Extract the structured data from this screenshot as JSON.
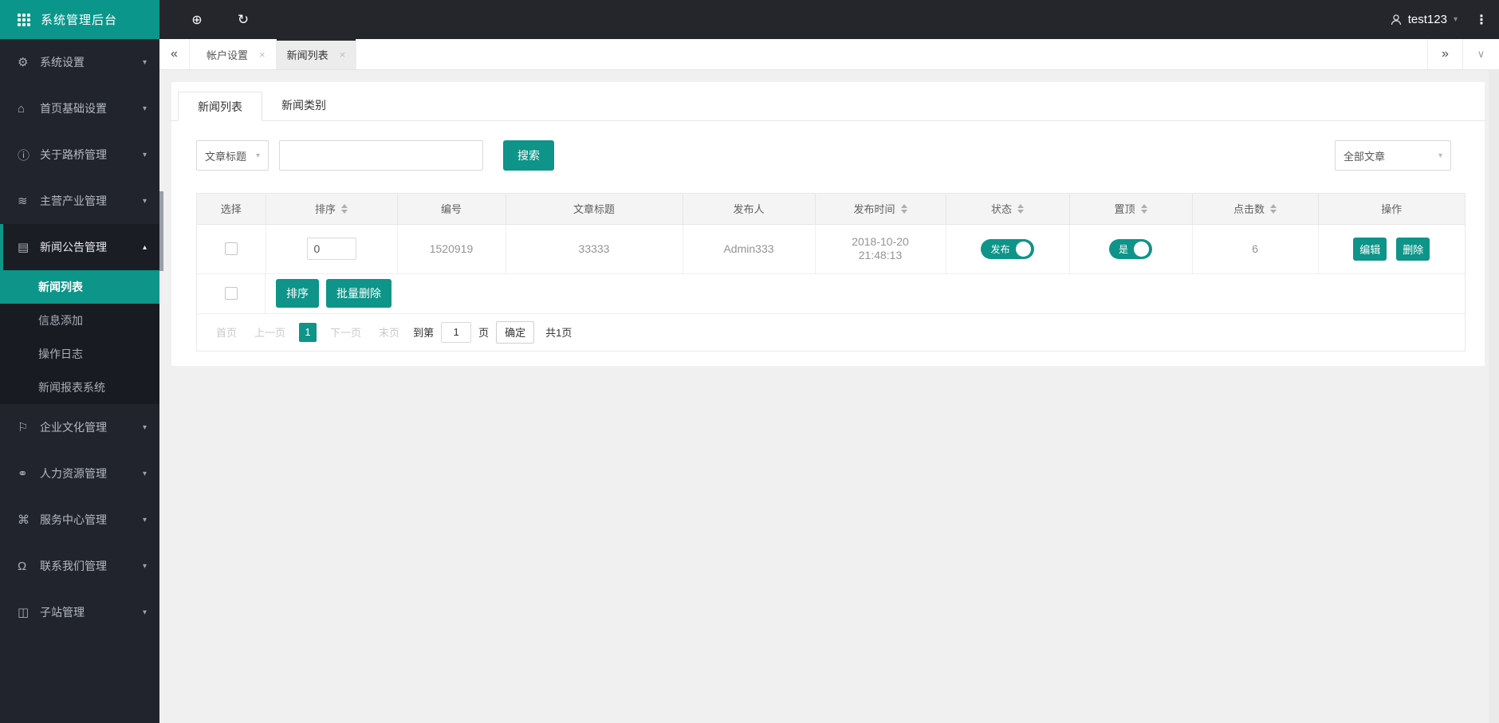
{
  "app_title": "系统管理后台",
  "topbar": {
    "username": "test123"
  },
  "icons": {
    "globe": "⊕",
    "refresh": "↻",
    "more": "⋮",
    "caret_down": "▾",
    "caret_up": "▴",
    "collapse_left": "«",
    "expand_right": "»",
    "chevron_down": "∨",
    "close": "×"
  },
  "window_tabs": [
    {
      "label": "帐户设置"
    },
    {
      "label": "新闻列表"
    }
  ],
  "sidebar": {
    "items": [
      {
        "label": "系统设置",
        "icon": "gear",
        "glyph": "⚙"
      },
      {
        "label": "首页基础设置",
        "icon": "home",
        "glyph": "⌂"
      },
      {
        "label": "关于路桥管理",
        "icon": "info",
        "glyph": "ⓘ"
      },
      {
        "label": "主营产业管理",
        "icon": "layers",
        "glyph": "≋"
      },
      {
        "label": "新闻公告管理",
        "icon": "document",
        "glyph": "▤",
        "children": [
          {
            "label": "新闻列表"
          },
          {
            "label": "信息添加"
          },
          {
            "label": "操作日志"
          },
          {
            "label": "新闻报表系统"
          }
        ]
      },
      {
        "label": "企业文化管理",
        "icon": "flag",
        "glyph": "⚐"
      },
      {
        "label": "人力资源管理",
        "icon": "users",
        "glyph": "⚭"
      },
      {
        "label": "服务中心管理",
        "icon": "command",
        "glyph": "⌘"
      },
      {
        "label": "联系我们管理",
        "icon": "headset",
        "glyph": "Ω"
      },
      {
        "label": "子站管理",
        "icon": "building",
        "glyph": "◫"
      }
    ]
  },
  "page": {
    "tabs": [
      {
        "label": "新闻列表"
      },
      {
        "label": "新闻类别"
      }
    ],
    "search": {
      "field": "文章标题",
      "keyword": "",
      "button": "搜索",
      "category": "全部文章"
    },
    "table": {
      "headers": [
        "选择",
        "排序",
        "编号",
        "文章标题",
        "发布人",
        "发布时间",
        "状态",
        "置顶",
        "点击数",
        "操作"
      ],
      "row": {
        "sort": "0",
        "id": "1520919",
        "title": "33333",
        "author": "Admin333",
        "date": "2018-10-20",
        "time": "21:48:13",
        "status": "发布",
        "pinned": "是",
        "clicks": "6",
        "edit": "编辑",
        "delete": "删除"
      },
      "batch": {
        "sort": "排序",
        "delete": "批量删除"
      }
    },
    "pagination": {
      "first": "首页",
      "prev": "上一页",
      "current": "1",
      "next": "下一页",
      "last": "末页",
      "goto_label": "到第",
      "goto_value": "1",
      "page_unit": "页",
      "confirm": "确定",
      "total": "共1页"
    }
  },
  "colors": {
    "accent": "#0e9488",
    "sidebar_bg": "#21242c",
    "topbar_bg": "#24262c",
    "content_bg": "#f0f0f1"
  }
}
